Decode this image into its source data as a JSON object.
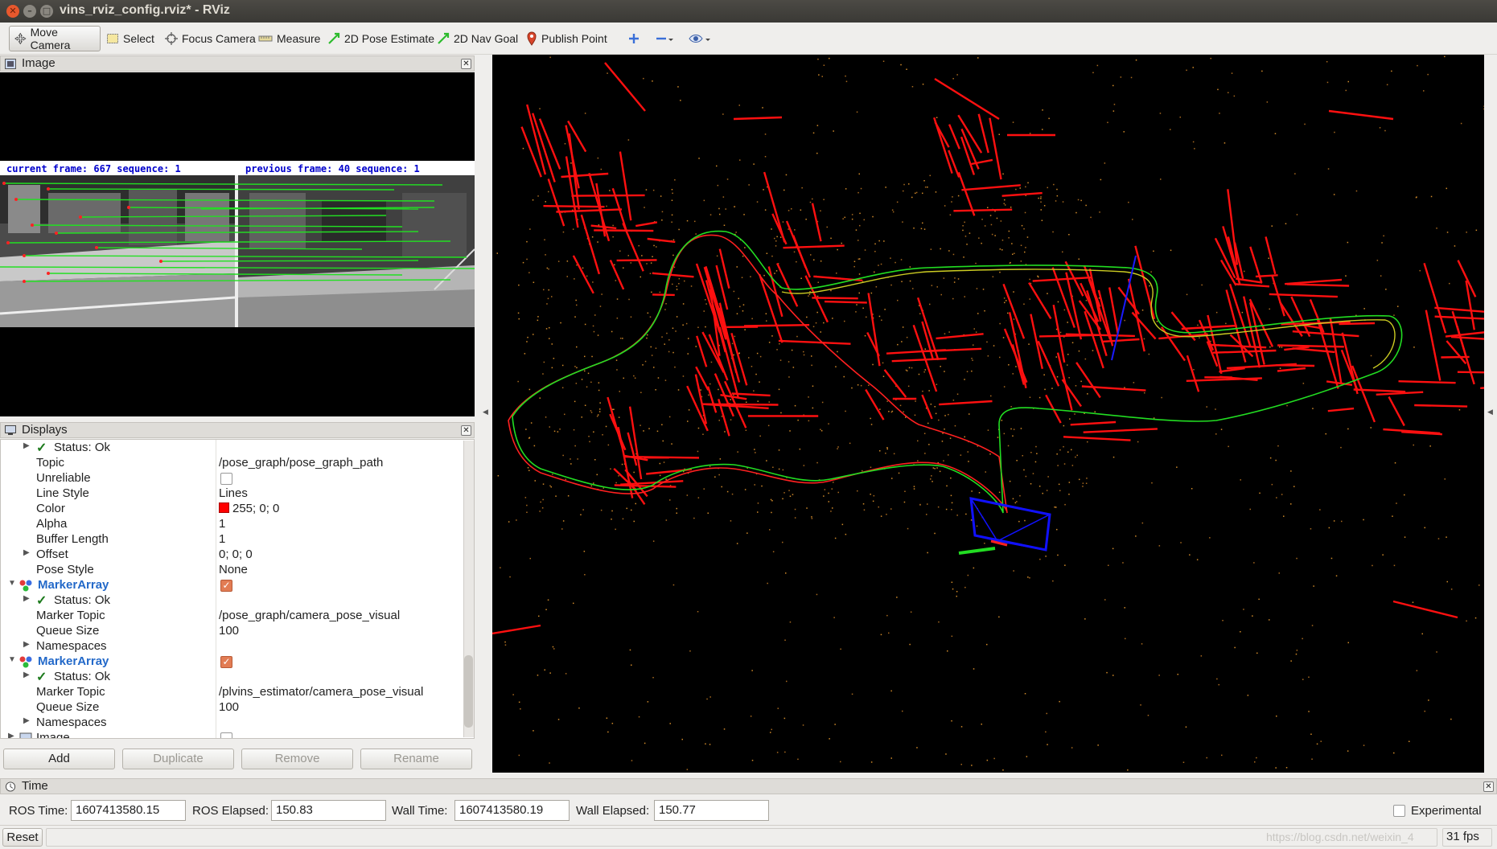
{
  "window": {
    "title": "vins_rviz_config.rviz* - RViz"
  },
  "toolbar": {
    "tools": [
      {
        "label": "Move Camera",
        "icon": "move-camera-icon",
        "active": true
      },
      {
        "label": "Select",
        "icon": "select-icon"
      },
      {
        "label": "Focus Camera",
        "icon": "focus-camera-icon"
      },
      {
        "label": "Measure",
        "icon": "measure-icon"
      },
      {
        "label": "2D Pose Estimate",
        "icon": "pose-estimate-icon"
      },
      {
        "label": "2D Nav Goal",
        "icon": "nav-goal-icon"
      },
      {
        "label": "Publish Point",
        "icon": "publish-point-icon"
      }
    ]
  },
  "image_panel": {
    "title": "Image",
    "overlay_left": "current frame: 667  sequence: 1",
    "overlay_right": "previous frame: 40  sequence: 1"
  },
  "displays_panel": {
    "title": "Displays",
    "rows": {
      "status_ok_1": "Status: Ok",
      "topic_label": "Topic",
      "topic_value": "/pose_graph/pose_graph_path",
      "unreliable_label": "Unreliable",
      "line_style_label": "Line Style",
      "line_style_value": "Lines",
      "color_label": "Color",
      "color_value": "255; 0; 0",
      "alpha_label": "Alpha",
      "alpha_value": "1",
      "buffer_label": "Buffer Length",
      "buffer_value": "1",
      "offset_label": "Offset",
      "offset_value": "0; 0; 0",
      "pose_style_label": "Pose Style",
      "pose_style_value": "None",
      "marker_array_1": "MarkerArray",
      "status_ok_2": "Status: Ok",
      "marker_topic_label_1": "Marker Topic",
      "marker_topic_value_1": "/pose_graph/camera_pose_visual",
      "queue_size_label_1": "Queue Size",
      "queue_size_value_1": "100",
      "namespaces_label_1": "Namespaces",
      "marker_array_2": "MarkerArray",
      "status_ok_3": "Status: Ok",
      "marker_topic_label_2": "Marker Topic",
      "marker_topic_value_2": "/plvins_estimator/camera_pose_visual",
      "queue_size_label_2": "Queue Size",
      "queue_size_value_2": "100",
      "namespaces_label_2": "Namespaces",
      "image_row_label": "Image"
    },
    "buttons": {
      "add": "Add",
      "duplicate": "Duplicate",
      "remove": "Remove",
      "rename": "Rename"
    }
  },
  "time_panel": {
    "title": "Time",
    "ros_time_label": "ROS Time:",
    "ros_time_value": "1607413580.15",
    "ros_elapsed_label": "ROS Elapsed:",
    "ros_elapsed_value": "150.83",
    "wall_time_label": "Wall Time:",
    "wall_time_value": "1607413580.19",
    "wall_elapsed_label": "Wall Elapsed:",
    "wall_elapsed_value": "150.77",
    "experimental_label": "Experimental"
  },
  "statusbar": {
    "reset_label": "Reset",
    "watermark": "https://blog.csdn.net/weixin_4",
    "fps": "31 fps"
  },
  "colors": {
    "path_red": "#ff0000",
    "path_green": "#22dd22",
    "path_yellow": "#cccc22",
    "camera_blue": "#1111ff",
    "marker_blue": "#2369c9"
  }
}
